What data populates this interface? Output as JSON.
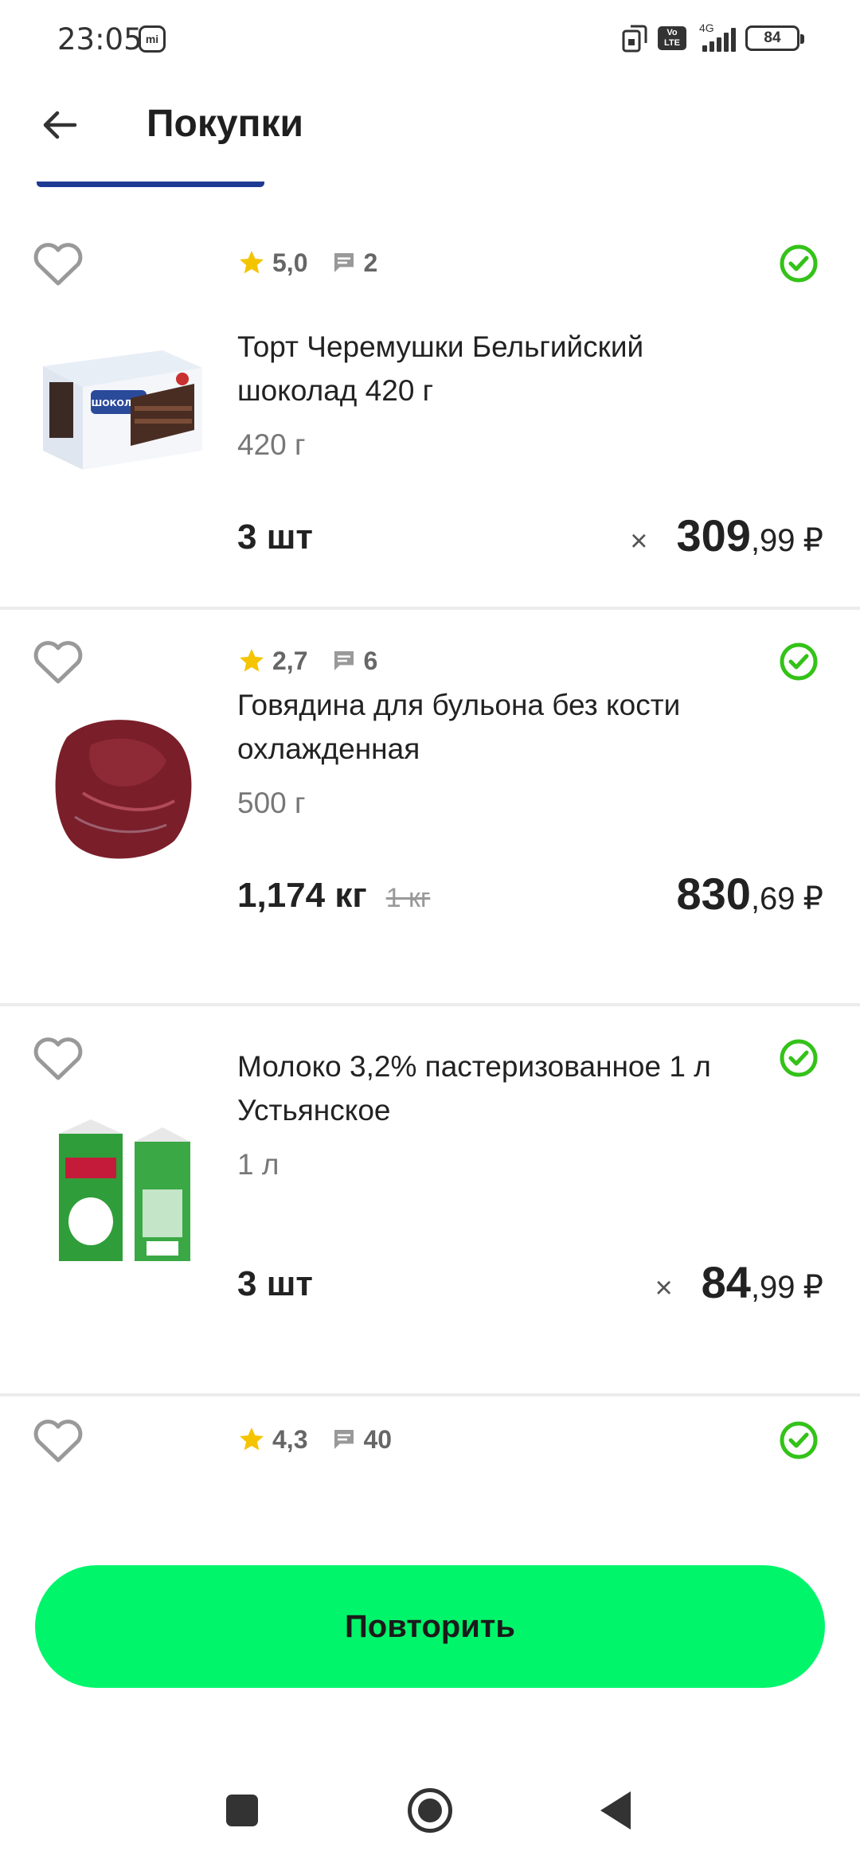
{
  "status_bar": {
    "time": "23:05",
    "mi_label": "mi",
    "network_type": "4G",
    "volte_label_1": "Vo",
    "volte_label_2": "LTE",
    "battery": "84"
  },
  "app_bar": {
    "title": "Покупки",
    "back_icon": "arrow-left-icon"
  },
  "items": [
    {
      "rating": "5,0",
      "reviews": "2",
      "name": "Торт Черемушки Бельгийский шоколад 420 г",
      "weight": "420 г",
      "quantity": "3 шт",
      "quantity_old": "",
      "multiplier": "×",
      "price_int": "309",
      "price_dec": ",99",
      "currency": "₽",
      "image_icon": "cake-box-image"
    },
    {
      "rating": "2,7",
      "reviews": "6",
      "name": "Говядина для бульона без кости охлажденная",
      "weight": "500 г",
      "quantity": "1,174 кг",
      "quantity_old": "1 кг",
      "multiplier": "",
      "price_int": "830",
      "price_dec": ",69",
      "currency": "₽",
      "image_icon": "beef-image"
    },
    {
      "rating": "",
      "reviews": "",
      "name": "Молоко 3,2% пастеризованное 1 л Устьянское",
      "weight": "1 л",
      "quantity": "3 шт",
      "quantity_old": "",
      "multiplier": "×",
      "price_int": "84",
      "price_dec": ",99",
      "currency": "₽",
      "image_icon": "milk-carton-image"
    },
    {
      "rating": "4,3",
      "reviews": "40",
      "image_icon": "product-image"
    }
  ],
  "repeat_button": {
    "label": "Повторить"
  },
  "colors": {
    "accent": "#00f56b",
    "check": "#34c219",
    "star": "#f5c400",
    "tab_indicator": "#1f3a93"
  }
}
